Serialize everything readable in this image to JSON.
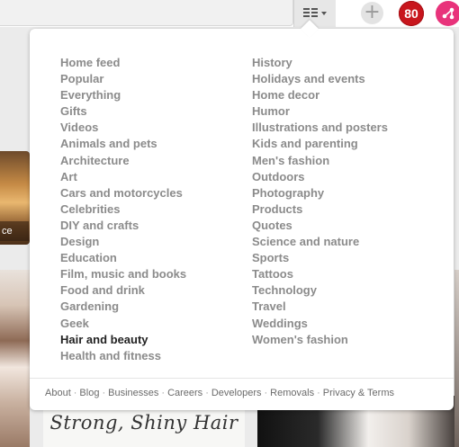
{
  "header": {
    "category_button_icon": "category-grid-icon",
    "add_icon": "plus-icon",
    "add_glyph": "+",
    "notifications_count": "80",
    "profile_icon": "pinterest-profile-icon"
  },
  "background_pins": {
    "left_pin_caption": "ce",
    "handwriting_text": "Strong, Shiny Hair"
  },
  "categories": {
    "column1": [
      "Home feed",
      "Popular",
      "Everything",
      "Gifts",
      "Videos",
      "Animals and pets",
      "Architecture",
      "Art",
      "Cars and motorcycles",
      "Celebrities",
      "DIY and crafts",
      "Design",
      "Education",
      "Film, music and books",
      "Food and drink",
      "Gardening",
      "Geek",
      "Hair and beauty",
      "Health and fitness"
    ],
    "column2": [
      "History",
      "Holidays and events",
      "Home decor",
      "Humor",
      "Illustrations and posters",
      "Kids and parenting",
      "Men's fashion",
      "Outdoors",
      "Photography",
      "Products",
      "Quotes",
      "Science and nature",
      "Sports",
      "Tattoos",
      "Technology",
      "Travel",
      "Weddings",
      "Women's fashion"
    ],
    "active": "Hair and beauty"
  },
  "footer": {
    "links": [
      "About",
      "Blog",
      "Businesses",
      "Careers",
      "Developers",
      "Removals",
      "Privacy & Terms"
    ],
    "separator": "·"
  },
  "colors": {
    "notification_badge": "#c8161d",
    "profile": "#e8337b",
    "category_text": "#8b8b8b",
    "active_category_text": "#222222"
  }
}
